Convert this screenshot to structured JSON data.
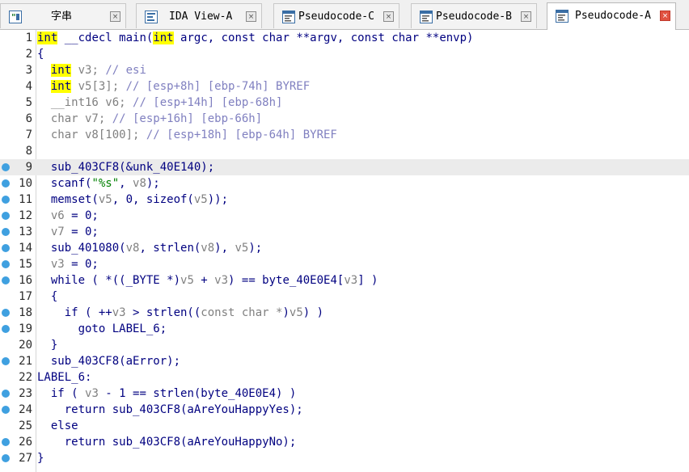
{
  "tabs": [
    {
      "label": "字串",
      "icon": "strings-window-icon",
      "active": false
    },
    {
      "label": "IDA View-A",
      "icon": "ida-view-icon",
      "active": false
    },
    {
      "label": "Pseudocode-C",
      "icon": "pseudocode-icon",
      "active": false
    },
    {
      "label": "Pseudocode-B",
      "icon": "pseudocode-icon",
      "active": false
    },
    {
      "label": "Pseudocode-A",
      "icon": "pseudocode-icon",
      "active": true
    }
  ],
  "close_glyph": "×",
  "colors": {
    "accent_close": "#e15241",
    "highlight_kw": "#ffff00",
    "breakpoint_dot": "#3fa0e0",
    "line_highlight": "#ebebeb"
  },
  "code_lines": [
    {
      "n": "1",
      "bp": false,
      "hl": false,
      "tokens": [
        [
          "int",
          "kwhl"
        ],
        [
          " __cdecl main(",
          "plain"
        ],
        [
          "int",
          "kwhl"
        ],
        [
          " argc, const char **argv, const char **envp)",
          "plain"
        ]
      ]
    },
    {
      "n": "2",
      "bp": false,
      "hl": false,
      "tokens": [
        [
          "{",
          "plain"
        ]
      ]
    },
    {
      "n": "3",
      "bp": false,
      "hl": false,
      "tokens": [
        [
          "  ",
          "plain"
        ],
        [
          "int",
          "kwhl"
        ],
        [
          " v3; ",
          "gray"
        ],
        [
          "// esi",
          "cmt"
        ]
      ]
    },
    {
      "n": "4",
      "bp": false,
      "hl": false,
      "tokens": [
        [
          "  ",
          "plain"
        ],
        [
          "int",
          "kwhl"
        ],
        [
          " v5[3]; ",
          "gray"
        ],
        [
          "// [esp+8h] [ebp-74h] BYREF",
          "cmt"
        ]
      ]
    },
    {
      "n": "5",
      "bp": false,
      "hl": false,
      "tokens": [
        [
          "  __int16 v6; ",
          "gray"
        ],
        [
          "// [esp+14h] [ebp-68h]",
          "cmt"
        ]
      ]
    },
    {
      "n": "6",
      "bp": false,
      "hl": false,
      "tokens": [
        [
          "  char v7; ",
          "gray"
        ],
        [
          "// [esp+16h] [ebp-66h]",
          "cmt"
        ]
      ]
    },
    {
      "n": "7",
      "bp": false,
      "hl": false,
      "tokens": [
        [
          "  char v8[100]; ",
          "gray"
        ],
        [
          "// [esp+18h] [ebp-64h] BYREF",
          "cmt"
        ]
      ]
    },
    {
      "n": "8",
      "bp": false,
      "hl": false,
      "tokens": []
    },
    {
      "n": "9",
      "bp": true,
      "hl": true,
      "tokens": [
        [
          "  sub_403CF8(&unk_40E140);",
          "plain"
        ]
      ]
    },
    {
      "n": "10",
      "bp": true,
      "hl": false,
      "tokens": [
        [
          "  scanf(",
          "plain"
        ],
        [
          "\"%s\"",
          "str"
        ],
        [
          ", ",
          "plain"
        ],
        [
          "v8",
          "gray"
        ],
        [
          ");",
          "plain"
        ]
      ]
    },
    {
      "n": "11",
      "bp": true,
      "hl": false,
      "tokens": [
        [
          "  memset(",
          "plain"
        ],
        [
          "v5",
          "gray"
        ],
        [
          ", 0, sizeof(",
          "plain"
        ],
        [
          "v5",
          "gray"
        ],
        [
          "));",
          "plain"
        ]
      ]
    },
    {
      "n": "12",
      "bp": true,
      "hl": false,
      "tokens": [
        [
          "  ",
          "plain"
        ],
        [
          "v6",
          "gray"
        ],
        [
          " = 0;",
          "plain"
        ]
      ]
    },
    {
      "n": "13",
      "bp": true,
      "hl": false,
      "tokens": [
        [
          "  ",
          "plain"
        ],
        [
          "v7",
          "gray"
        ],
        [
          " = 0;",
          "plain"
        ]
      ]
    },
    {
      "n": "14",
      "bp": true,
      "hl": false,
      "tokens": [
        [
          "  sub_401080(",
          "plain"
        ],
        [
          "v8",
          "gray"
        ],
        [
          ", strlen(",
          "plain"
        ],
        [
          "v8",
          "gray"
        ],
        [
          "), ",
          "plain"
        ],
        [
          "v5",
          "gray"
        ],
        [
          ");",
          "plain"
        ]
      ]
    },
    {
      "n": "15",
      "bp": true,
      "hl": false,
      "tokens": [
        [
          "  ",
          "plain"
        ],
        [
          "v3",
          "gray"
        ],
        [
          " = 0;",
          "plain"
        ]
      ]
    },
    {
      "n": "16",
      "bp": true,
      "hl": false,
      "tokens": [
        [
          "  while ( *((_BYTE *)",
          "plain"
        ],
        [
          "v5",
          "gray"
        ],
        [
          " + ",
          "plain"
        ],
        [
          "v3",
          "gray"
        ],
        [
          ") == byte_40E0E4[",
          "plain"
        ],
        [
          "v3",
          "gray"
        ],
        [
          "] )",
          "plain"
        ]
      ]
    },
    {
      "n": "17",
      "bp": false,
      "hl": false,
      "tokens": [
        [
          "  {",
          "plain"
        ]
      ]
    },
    {
      "n": "18",
      "bp": true,
      "hl": false,
      "tokens": [
        [
          "    if ( ++",
          "plain"
        ],
        [
          "v3",
          "gray"
        ],
        [
          " > strlen((",
          "plain"
        ],
        [
          "const char *",
          "gray"
        ],
        [
          ")",
          "plain"
        ],
        [
          "v5",
          "gray"
        ],
        [
          ") )",
          "plain"
        ]
      ]
    },
    {
      "n": "19",
      "bp": true,
      "hl": false,
      "tokens": [
        [
          "      goto LABEL_6;",
          "plain"
        ]
      ]
    },
    {
      "n": "20",
      "bp": false,
      "hl": false,
      "tokens": [
        [
          "  }",
          "plain"
        ]
      ]
    },
    {
      "n": "21",
      "bp": true,
      "hl": false,
      "tokens": [
        [
          "  sub_403CF8(aError);",
          "plain"
        ]
      ]
    },
    {
      "n": "22",
      "bp": false,
      "hl": false,
      "tokens": [
        [
          "LABEL_6:",
          "plain"
        ]
      ]
    },
    {
      "n": "23",
      "bp": true,
      "hl": false,
      "tokens": [
        [
          "  if ( ",
          "plain"
        ],
        [
          "v3",
          "gray"
        ],
        [
          " - 1 == strlen(byte_40E0E4) )",
          "plain"
        ]
      ]
    },
    {
      "n": "24",
      "bp": true,
      "hl": false,
      "tokens": [
        [
          "    return sub_403CF8(aAreYouHappyYes);",
          "plain"
        ]
      ]
    },
    {
      "n": "25",
      "bp": false,
      "hl": false,
      "tokens": [
        [
          "  else",
          "plain"
        ]
      ]
    },
    {
      "n": "26",
      "bp": true,
      "hl": false,
      "tokens": [
        [
          "    return sub_403CF8(aAreYouHappyNo);",
          "plain"
        ]
      ]
    },
    {
      "n": "27",
      "bp": true,
      "hl": false,
      "tokens": [
        [
          "}",
          "plain"
        ]
      ]
    }
  ]
}
